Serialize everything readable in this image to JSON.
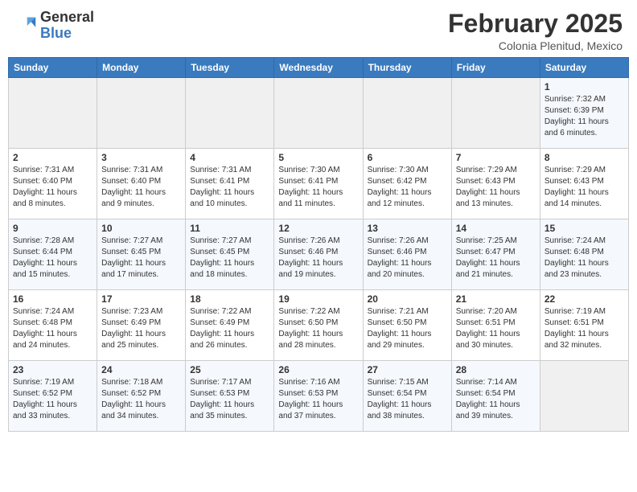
{
  "header": {
    "logo_general": "General",
    "logo_blue": "Blue",
    "month_title": "February 2025",
    "subtitle": "Colonia Plenitud, Mexico"
  },
  "days_of_week": [
    "Sunday",
    "Monday",
    "Tuesday",
    "Wednesday",
    "Thursday",
    "Friday",
    "Saturday"
  ],
  "weeks": [
    [
      {
        "day": "",
        "info": ""
      },
      {
        "day": "",
        "info": ""
      },
      {
        "day": "",
        "info": ""
      },
      {
        "day": "",
        "info": ""
      },
      {
        "day": "",
        "info": ""
      },
      {
        "day": "",
        "info": ""
      },
      {
        "day": "1",
        "info": "Sunrise: 7:32 AM\nSunset: 6:39 PM\nDaylight: 11 hours and 6 minutes."
      }
    ],
    [
      {
        "day": "2",
        "info": "Sunrise: 7:31 AM\nSunset: 6:40 PM\nDaylight: 11 hours and 8 minutes."
      },
      {
        "day": "3",
        "info": "Sunrise: 7:31 AM\nSunset: 6:40 PM\nDaylight: 11 hours and 9 minutes."
      },
      {
        "day": "4",
        "info": "Sunrise: 7:31 AM\nSunset: 6:41 PM\nDaylight: 11 hours and 10 minutes."
      },
      {
        "day": "5",
        "info": "Sunrise: 7:30 AM\nSunset: 6:41 PM\nDaylight: 11 hours and 11 minutes."
      },
      {
        "day": "6",
        "info": "Sunrise: 7:30 AM\nSunset: 6:42 PM\nDaylight: 11 hours and 12 minutes."
      },
      {
        "day": "7",
        "info": "Sunrise: 7:29 AM\nSunset: 6:43 PM\nDaylight: 11 hours and 13 minutes."
      },
      {
        "day": "8",
        "info": "Sunrise: 7:29 AM\nSunset: 6:43 PM\nDaylight: 11 hours and 14 minutes."
      }
    ],
    [
      {
        "day": "9",
        "info": "Sunrise: 7:28 AM\nSunset: 6:44 PM\nDaylight: 11 hours and 15 minutes."
      },
      {
        "day": "10",
        "info": "Sunrise: 7:27 AM\nSunset: 6:45 PM\nDaylight: 11 hours and 17 minutes."
      },
      {
        "day": "11",
        "info": "Sunrise: 7:27 AM\nSunset: 6:45 PM\nDaylight: 11 hours and 18 minutes."
      },
      {
        "day": "12",
        "info": "Sunrise: 7:26 AM\nSunset: 6:46 PM\nDaylight: 11 hours and 19 minutes."
      },
      {
        "day": "13",
        "info": "Sunrise: 7:26 AM\nSunset: 6:46 PM\nDaylight: 11 hours and 20 minutes."
      },
      {
        "day": "14",
        "info": "Sunrise: 7:25 AM\nSunset: 6:47 PM\nDaylight: 11 hours and 21 minutes."
      },
      {
        "day": "15",
        "info": "Sunrise: 7:24 AM\nSunset: 6:48 PM\nDaylight: 11 hours and 23 minutes."
      }
    ],
    [
      {
        "day": "16",
        "info": "Sunrise: 7:24 AM\nSunset: 6:48 PM\nDaylight: 11 hours and 24 minutes."
      },
      {
        "day": "17",
        "info": "Sunrise: 7:23 AM\nSunset: 6:49 PM\nDaylight: 11 hours and 25 minutes."
      },
      {
        "day": "18",
        "info": "Sunrise: 7:22 AM\nSunset: 6:49 PM\nDaylight: 11 hours and 26 minutes."
      },
      {
        "day": "19",
        "info": "Sunrise: 7:22 AM\nSunset: 6:50 PM\nDaylight: 11 hours and 28 minutes."
      },
      {
        "day": "20",
        "info": "Sunrise: 7:21 AM\nSunset: 6:50 PM\nDaylight: 11 hours and 29 minutes."
      },
      {
        "day": "21",
        "info": "Sunrise: 7:20 AM\nSunset: 6:51 PM\nDaylight: 11 hours and 30 minutes."
      },
      {
        "day": "22",
        "info": "Sunrise: 7:19 AM\nSunset: 6:51 PM\nDaylight: 11 hours and 32 minutes."
      }
    ],
    [
      {
        "day": "23",
        "info": "Sunrise: 7:19 AM\nSunset: 6:52 PM\nDaylight: 11 hours and 33 minutes."
      },
      {
        "day": "24",
        "info": "Sunrise: 7:18 AM\nSunset: 6:52 PM\nDaylight: 11 hours and 34 minutes."
      },
      {
        "day": "25",
        "info": "Sunrise: 7:17 AM\nSunset: 6:53 PM\nDaylight: 11 hours and 35 minutes."
      },
      {
        "day": "26",
        "info": "Sunrise: 7:16 AM\nSunset: 6:53 PM\nDaylight: 11 hours and 37 minutes."
      },
      {
        "day": "27",
        "info": "Sunrise: 7:15 AM\nSunset: 6:54 PM\nDaylight: 11 hours and 38 minutes."
      },
      {
        "day": "28",
        "info": "Sunrise: 7:14 AM\nSunset: 6:54 PM\nDaylight: 11 hours and 39 minutes."
      },
      {
        "day": "",
        "info": ""
      }
    ]
  ]
}
